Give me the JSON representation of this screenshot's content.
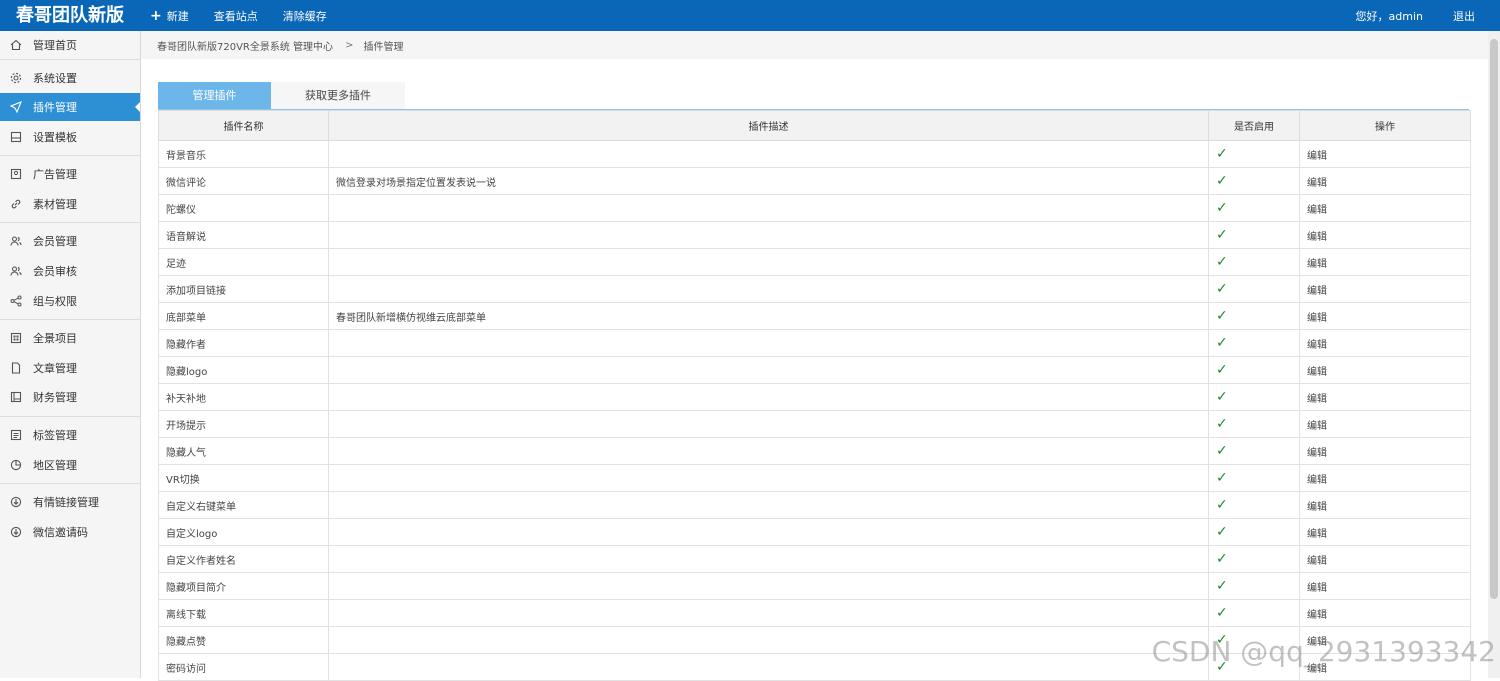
{
  "app": {
    "title": "春哥团队新版",
    "nav": {
      "new_label": "新建",
      "view_site": "查看站点",
      "clear_cache": "清除缓存"
    },
    "greeting": "您好，admin",
    "logout": "退出"
  },
  "sidebar": {
    "items": [
      {
        "label": "管理首页",
        "icon": "home-icon"
      },
      {
        "label": "系统设置",
        "icon": "gear-icon"
      },
      {
        "label": "插件管理",
        "icon": "paper-plane-icon"
      },
      {
        "label": "设置模板",
        "icon": "template-icon"
      },
      {
        "label": "广告管理",
        "icon": "ad-icon"
      },
      {
        "label": "素材管理",
        "icon": "link-icon"
      },
      {
        "label": "会员管理",
        "icon": "users-icon"
      },
      {
        "label": "会员审核",
        "icon": "users-icon"
      },
      {
        "label": "组与权限",
        "icon": "share-icon"
      },
      {
        "label": "全景项目",
        "icon": "grid-icon"
      },
      {
        "label": "文章管理",
        "icon": "document-icon"
      },
      {
        "label": "财务管理",
        "icon": "ledger-icon"
      },
      {
        "label": "标签管理",
        "icon": "list-icon"
      },
      {
        "label": "地区管理",
        "icon": "pie-icon"
      },
      {
        "label": "有情链接管理",
        "icon": "download-circle-icon"
      },
      {
        "label": "微信邀请码",
        "icon": "download-circle-icon"
      }
    ]
  },
  "breadcrumb": {
    "root": "春哥团队新版720VR全景系统 管理中心",
    "separator": ">",
    "current": "插件管理"
  },
  "tabs": {
    "manage": "管理插件",
    "more": "获取更多插件"
  },
  "table": {
    "headers": [
      "插件名称",
      "插件描述",
      "是否启用",
      "操作"
    ],
    "enabled_mark": "✓",
    "edit_label": "编辑",
    "rows": [
      {
        "name": "背景音乐",
        "desc": ""
      },
      {
        "name": "微信评论",
        "desc": "微信登录对场景指定位置发表说一说"
      },
      {
        "name": "陀螺仪",
        "desc": ""
      },
      {
        "name": "语音解说",
        "desc": ""
      },
      {
        "name": "足迹",
        "desc": ""
      },
      {
        "name": "添加项目链接",
        "desc": ""
      },
      {
        "name": "底部菜单",
        "desc": "春哥团队新增横仿视维云底部菜单"
      },
      {
        "name": "隐藏作者",
        "desc": ""
      },
      {
        "name": "隐藏logo",
        "desc": ""
      },
      {
        "name": "补天补地",
        "desc": ""
      },
      {
        "name": "开场提示",
        "desc": ""
      },
      {
        "name": "隐藏人气",
        "desc": ""
      },
      {
        "name": "VR切换",
        "desc": ""
      },
      {
        "name": "自定义右键菜单",
        "desc": ""
      },
      {
        "name": "自定义logo",
        "desc": ""
      },
      {
        "name": "自定义作者姓名",
        "desc": ""
      },
      {
        "name": "隐藏项目简介",
        "desc": ""
      },
      {
        "name": "离线下载",
        "desc": ""
      },
      {
        "name": "隐藏点赞",
        "desc": ""
      },
      {
        "name": "密码访问",
        "desc": ""
      }
    ]
  },
  "watermark": "CSDN @qq_2931393342",
  "colors": {
    "topbar": "#0a66b7",
    "active_sidebar": "#2d8fd4",
    "active_tab": "#6cb6ea",
    "check": "#1d8a2f"
  }
}
